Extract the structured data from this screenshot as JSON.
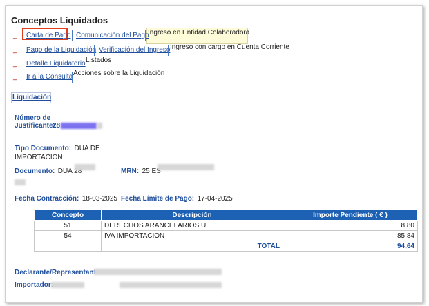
{
  "title": "Conceptos Liquidados",
  "menu": {
    "dash": "_",
    "row1": {
      "link1": "Carta de Pago",
      "link2": "Comunicación del Pago",
      "text": "Ingreso en Entidad Colaboradora"
    },
    "row2": {
      "link1": "Pago de la Liquidación",
      "link2": "Verificación del Ingreso",
      "text": "Ingreso con cargo en Cuenta Corriente"
    },
    "row3": {
      "link1": "Detalle Liquidatorio",
      "text": "Listados"
    },
    "row4": {
      "link1": "Ir a la Consulta",
      "text": "Acciones sobre la Liquidación"
    }
  },
  "tab": "Liquidación",
  "fields": {
    "justificante_label": "Número de Justificante:",
    "justificante_value": "28",
    "tipo_doc_label": "Tipo Documento:",
    "tipo_doc_value": "DUA DE IMPORTACION",
    "documento_label": "Documento:",
    "documento_value": "DUA 28",
    "mrn_label": "MRN:",
    "mrn_value": "25 ES",
    "fecha_contraccion_label": "Fecha Contracción:",
    "fecha_contraccion_value": "18-03-2025",
    "fecha_limite_label": "Fecha Límite de Pago:",
    "fecha_limite_value": "17-04-2025",
    "declarante_label": "Declarante/Representante:",
    "importador_label": "Importador:"
  },
  "table": {
    "headers": [
      "Concepto",
      "Descripción",
      "Importe Pendiente ( € )"
    ],
    "rows": [
      {
        "concepto": "51",
        "descripcion": "DERECHOS ARANCELARIOS UE",
        "importe": "8,80"
      },
      {
        "concepto": "54",
        "descripcion": "IVA IMPORTACION",
        "importe": "85,84"
      }
    ],
    "total_label": "TOTAL",
    "total_value": "94,64"
  }
}
